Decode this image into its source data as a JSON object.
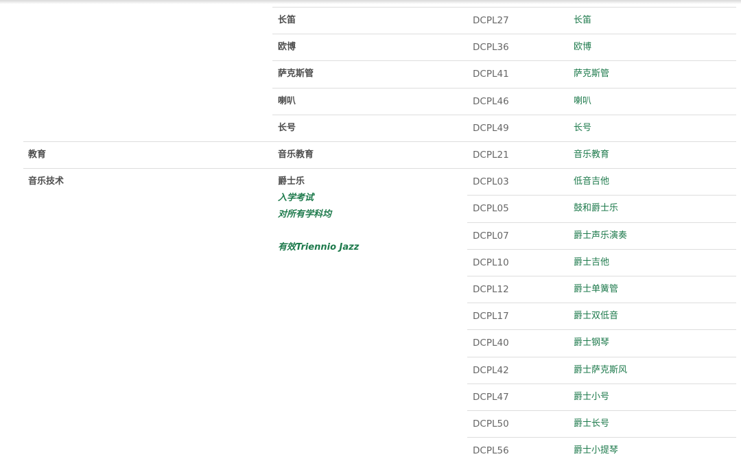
{
  "table": {
    "rows": [
      {
        "group": "",
        "course": "长笛",
        "code": "DCPL27",
        "name": "长笛"
      },
      {
        "group": "",
        "course": "欧博",
        "code": "DCPL36",
        "name": "欧博"
      },
      {
        "group": "",
        "course": "萨克斯管",
        "code": "DCPL41",
        "name": "萨克斯管"
      },
      {
        "group": "",
        "course": "喇叭",
        "code": "DCPL46",
        "name": "喇叭"
      },
      {
        "group": "",
        "course": "长号",
        "code": "DCPL49",
        "name": "长号"
      },
      {
        "group": "教育",
        "course": "音乐教育",
        "code": "DCPL21",
        "name": "音乐教育"
      },
      {
        "group": "音乐技术",
        "course": "爵士乐",
        "code": "DCPL03",
        "name": "低音吉他"
      },
      {
        "group": "",
        "course": "",
        "code": "DCPL05",
        "name": "鼓和爵士乐"
      },
      {
        "group": "",
        "course": "",
        "code": "DCPL07",
        "name": "爵士声乐演奏"
      },
      {
        "group": "",
        "course": "",
        "code": "DCPL10",
        "name": "爵士吉他"
      },
      {
        "group": "",
        "course": "",
        "code": "DCPL12",
        "name": "爵士单簧管"
      },
      {
        "group": "",
        "course": "",
        "code": "DCPL17",
        "name": "爵士双低音"
      },
      {
        "group": "",
        "course": "",
        "code": "DCPL40",
        "name": "爵士钢琴"
      },
      {
        "group": "",
        "course": "",
        "code": "DCPL42",
        "name": "爵士萨克斯风"
      },
      {
        "group": "",
        "course": "",
        "code": "DCPL47",
        "name": "爵士小号"
      },
      {
        "group": "",
        "course": "",
        "code": "DCPL50",
        "name": "爵士长号"
      },
      {
        "group": "",
        "course": "",
        "code": "DCPL56",
        "name": "爵士小提琴"
      }
    ],
    "jazz_notes": [
      "入学考试",
      "对所有学科均",
      "有效Triennio Jazz"
    ]
  },
  "colors": {
    "link": "#1e7a4c",
    "text": "#555555",
    "border": "#dddddd"
  }
}
